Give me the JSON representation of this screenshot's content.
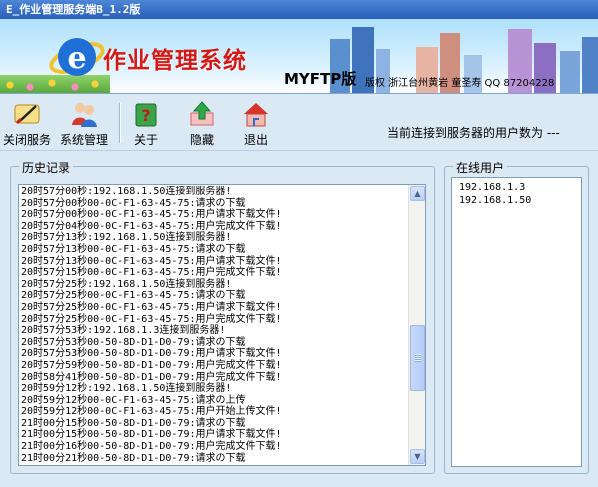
{
  "window": {
    "title": "E_作业管理服务端B_1.2版"
  },
  "banner": {
    "app_title": "作业管理系统",
    "version": "MYFTP版",
    "copyright": "版权 浙江台州黄岩 童圣寿 QQ 87204228"
  },
  "toolbar": {
    "items": [
      {
        "label": "关闭服务",
        "icon": "close-service-icon"
      },
      {
        "label": "系统管理",
        "icon": "users-admin-icon"
      },
      {
        "label": "关于",
        "icon": "help-book-icon"
      },
      {
        "label": "隐藏",
        "icon": "hide-arrow-icon"
      },
      {
        "label": "退出",
        "icon": "exit-house-icon"
      }
    ],
    "status": "当前连接到服务器的用户数为 ---"
  },
  "history": {
    "title": "历史记录",
    "lines": [
      "20时57分00秒:192.168.1.50连接到服务器!",
      "20时57分00秒00-0C-F1-63-45-75:请求の下载",
      "20时57分00秒00-0C-F1-63-45-75:用户请求下载文件!",
      "20时57分04秒00-0C-F1-63-45-75:用户完成文件下载!",
      "20时57分13秒:192.168.1.50连接到服务器!",
      "20时57分13秒00-0C-F1-63-45-75:请求の下载",
      "20时57分13秒00-0C-F1-63-45-75:用户请求下载文件!",
      "20时57分15秒00-0C-F1-63-45-75:用户完成文件下载!",
      "20时57分25秒:192.168.1.50连接到服务器!",
      "20时57分25秒00-0C-F1-63-45-75:请求の下载",
      "20时57分25秒00-0C-F1-63-45-75:用户请求下载文件!",
      "20时57分25秒00-0C-F1-63-45-75:用户完成文件下载!",
      "20时57分53秒:192.168.1.3连接到服务器!",
      "20时57分53秒00-50-8D-D1-D0-79:请求の下载",
      "20时57分53秒00-50-8D-D1-D0-79:用户请求下载文件!",
      "20时57分59秒00-50-8D-D1-D0-79:用户完成文件下载!",
      "20时58分41秒00-50-8D-D1-D0-79:用户完成文件下载!",
      "20时59分12秒:192.168.1.50连接到服务器!",
      "20时59分12秒00-0C-F1-63-45-75:请求の上传",
      "20时59分12秒00-0C-F1-63-45-75:用户开始上传文件!",
      "21时00分15秒00-50-8D-D1-D0-79:请求の下载",
      "21时00分15秒00-50-8D-D1-D0-79:用户请求下载文件!",
      "21时00分16秒00-50-8D-D1-D0-79:用户完成文件下载!",
      "21时00分21秒00-50-8D-D1-D0-79:请求の下载"
    ]
  },
  "online": {
    "title": "在线用户",
    "users": [
      "192.168.1.3",
      "192.168.1.50"
    ]
  },
  "scrollbar": {
    "up_glyph": "▲",
    "down_glyph": "▼"
  }
}
